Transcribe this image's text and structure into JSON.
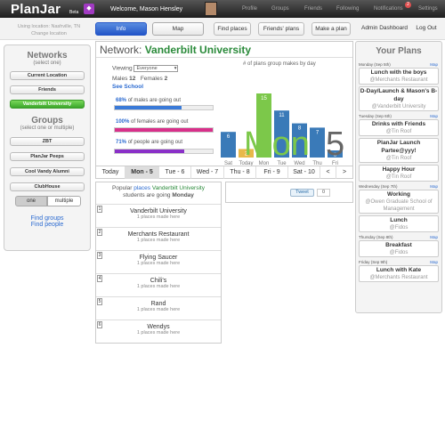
{
  "topbar": {
    "logo": "PlanJar",
    "beta": "Beta",
    "welcome": "Welcome, Mason Hensley",
    "nav": [
      "Profile",
      "Groups",
      "Friends",
      "Following",
      "Notifications",
      "Settings"
    ],
    "notification_count": "2"
  },
  "subbar": {
    "location_line1": "Using location: Nashville, TN",
    "location_line2": "Change location",
    "tabs": [
      {
        "label": "Info",
        "active": true
      },
      {
        "label": "Map",
        "active": false
      }
    ],
    "actions": [
      "Find places",
      "Friends' plans",
      "Make a plan",
      "Admin Dashboard",
      "Log Out"
    ]
  },
  "sidebar": {
    "networks_title": "Networks",
    "networks_sub": "(select one)",
    "networks": [
      {
        "label": "Current Location",
        "selected": false
      },
      {
        "label": "Friends",
        "selected": false
      },
      {
        "label": "Vanderbilt University",
        "selected": true
      }
    ],
    "groups_title": "Groups",
    "groups_sub": "(select one or multiple)",
    "groups": [
      "ZBT",
      "PlanJar Peeps",
      "Cool Vandy Alumni",
      "ClubHouse"
    ],
    "toggle": [
      "one",
      "multiple"
    ],
    "find_groups": "Find groups",
    "find_people": "Find people"
  },
  "network": {
    "title_prefix": "Network:",
    "title_name": "Vanderbilt University",
    "viewing_label": "Viewing",
    "viewing_value": "Everyone",
    "males_label": "Males",
    "males_value": "12",
    "females_label": "Females",
    "females_value": "2",
    "school_label": "See School",
    "stats": [
      {
        "pct": "68%",
        "text": "of males are going out",
        "value": 68,
        "color": "#3a7ad8"
      },
      {
        "pct": "100%",
        "text": "of females are going out",
        "value": 100,
        "color": "#d8308a"
      },
      {
        "pct": "71%",
        "text": "of people are going out",
        "value": 71,
        "color": "#8a30c8"
      }
    ],
    "chart_title": "# of plans group makes by day",
    "big_day": "Mon",
    "big_date": "5",
    "colors": {
      "accent": "#3a7ab8",
      "today": "#e8b84a",
      "selected": "#7cc84a",
      "big_day": "#7cc84a"
    }
  },
  "chart_data": {
    "type": "bar",
    "title": "# of plans group makes by day",
    "categories": [
      "Sat",
      "Today",
      "Mon",
      "Tue",
      "Wed",
      "Thu",
      "Fri"
    ],
    "values": [
      6,
      2,
      15,
      11,
      8,
      7,
      0
    ],
    "highlight": {
      "Today": "#e8b84a",
      "Mon": "#7cc84a"
    },
    "ylim": [
      0,
      15
    ]
  },
  "days": [
    {
      "label": "Today",
      "selected": false
    },
    {
      "label": "Mon - 5",
      "selected": true
    },
    {
      "label": "Tue - 6",
      "selected": false
    },
    {
      "label": "Wed - 7",
      "selected": false
    },
    {
      "label": "Thu - 8",
      "selected": false
    },
    {
      "label": "Fri - 9",
      "selected": false
    },
    {
      "label": "Sat - 10",
      "selected": false
    }
  ],
  "day_nav": {
    "prev": "<",
    "next": ">"
  },
  "popular": {
    "head_a": "Popular",
    "head_b": "places",
    "head_c": "Vanderbilt University",
    "head_d": "students are going",
    "head_e": "Monday",
    "rows": [
      {
        "num": "1",
        "name": "Vanderbilt University",
        "count": "1 places made here"
      },
      {
        "num": "2",
        "name": "Merchants Restaurant",
        "count": "1 places made here"
      },
      {
        "num": "3",
        "name": "Flying Saucer",
        "count": "1 places made here"
      },
      {
        "num": "4",
        "name": "Chili's",
        "count": "1 places made here"
      },
      {
        "num": "5",
        "name": "Rand",
        "count": "1 places made here"
      },
      {
        "num": "6",
        "name": "Wendys",
        "count": "1 places made here"
      }
    ]
  },
  "tweet": {
    "label": "Tweet",
    "count": "0"
  },
  "plans": {
    "title": "Your Plans",
    "map_label": "Map",
    "groups": [
      {
        "day": "Monday (Sep 5th)",
        "items": [
          {
            "title": "Lunch with the boys",
            "where": "@Merchants Restaurant"
          },
          {
            "title": "D-Day/Launch & Mason's B-day",
            "where": "@Vanderbilt University"
          }
        ]
      },
      {
        "day": "Tuesday (Sep 6th)",
        "items": [
          {
            "title": "Drinks with Friends",
            "where": "@Tin Roof"
          },
          {
            "title": "PlanJar Launch Partee@yyy!",
            "where": "@Tin Roof"
          },
          {
            "title": "Happy Hour",
            "where": "@Tin Roof"
          }
        ]
      },
      {
        "day": "Wednesday (Sep 7th)",
        "items": [
          {
            "title": "Working",
            "where": "@Owen Graduate School of Management"
          },
          {
            "title": "Lunch",
            "where": "@Fidos"
          }
        ]
      },
      {
        "day": "Thursday (Sep 8th)",
        "items": [
          {
            "title": "Breakfast",
            "where": "@Fidos"
          }
        ]
      },
      {
        "day": "Friday (Sep 9th)",
        "items": [
          {
            "title": "Lunch with Kate",
            "where": "@Merchants Restaurant"
          }
        ]
      }
    ]
  }
}
